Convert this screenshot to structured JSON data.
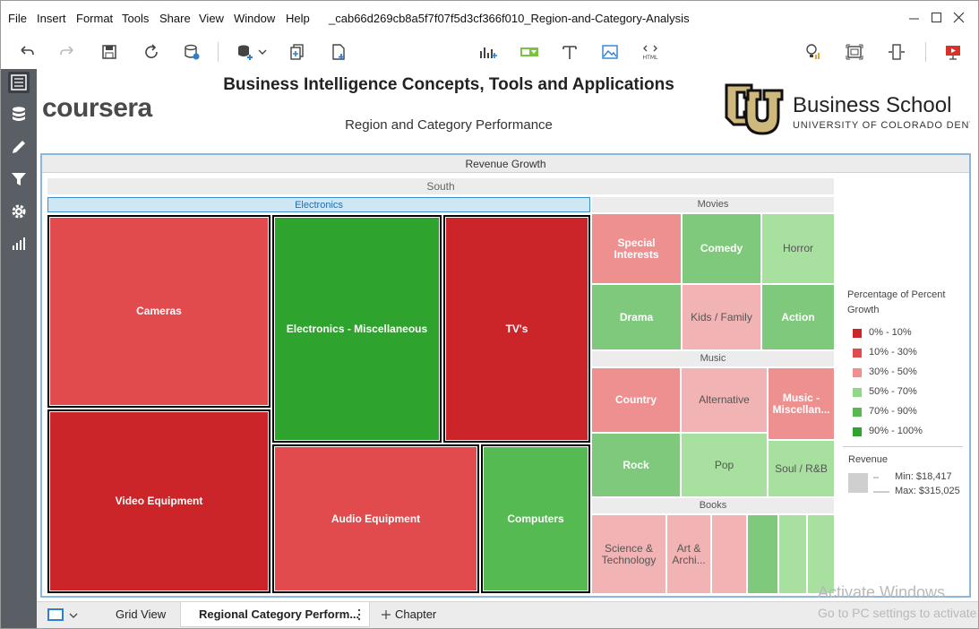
{
  "menu": [
    "File",
    "Insert",
    "Format",
    "Tools",
    "Share",
    "View",
    "Window",
    "Help"
  ],
  "document_title": "_cab66d269cb8a5f7f07f5d3cf366f010_Region-and-Category-Analysis",
  "report": {
    "title": "Business Intelligence Concepts, Tools and Applications",
    "subtitle": "Region and Category Performance",
    "left_logo": "coursera",
    "right_logo_name": "Business School",
    "right_logo_sub": "UNIVERSITY OF COLORADO DENVER"
  },
  "viz": {
    "header": "Revenue Growth",
    "region": "South",
    "groups": {
      "electronics": "Electronics",
      "movies": "Movies",
      "music": "Music",
      "books": "Books"
    },
    "cells": {
      "cameras": "Cameras",
      "video_equipment": "Video Equipment",
      "electronics_misc": "Electronics - Miscellaneous",
      "tvs": "TV's",
      "audio_equipment": "Audio Equipment",
      "computers": "Computers",
      "special_interests": "Special Interests",
      "comedy": "Comedy",
      "horror": "Horror",
      "drama": "Drama",
      "kids_family": "Kids / Family",
      "action": "Action",
      "country": "Country",
      "alternative": "Alternative",
      "music_misc": "Music - Miscellan...",
      "rock": "Rock",
      "pop": "Pop",
      "soul_rb": "Soul / R&B",
      "science_tech": "Science & Technology",
      "art_archi": "Art & Archi..."
    },
    "colors": {
      "dark_red": "#cc2529",
      "red": "#e24b4e",
      "pink": "#ee8f90",
      "light_pink": "#f2b3b4",
      "light_green": "#a8e0a0",
      "green": "#7ec97b",
      "mid_green": "#56ba52",
      "dark_green": "#2ea32d"
    }
  },
  "legend": {
    "title": "Percentage of Percent Growth",
    "items": [
      {
        "label": "0% - 10%",
        "color": "#cc2529"
      },
      {
        "label": "10% - 30%",
        "color": "#e24b4e"
      },
      {
        "label": "30% - 50%",
        "color": "#ee8f90"
      },
      {
        "label": "50% - 70%",
        "color": "#8fd88a"
      },
      {
        "label": "70% - 90%",
        "color": "#56ba52"
      },
      {
        "label": "90% - 100%",
        "color": "#2ea32d"
      }
    ],
    "revenue_title": "Revenue",
    "revenue_min": "Min: $18,417",
    "revenue_max": "Max: $315,025"
  },
  "tabs": {
    "grid_view": "Grid View",
    "active": "Regional Category Perform...",
    "chapter": "Chapter"
  },
  "watermark": {
    "line1": "Activate Windows",
    "line2": "Go to PC settings to activate Windows."
  }
}
